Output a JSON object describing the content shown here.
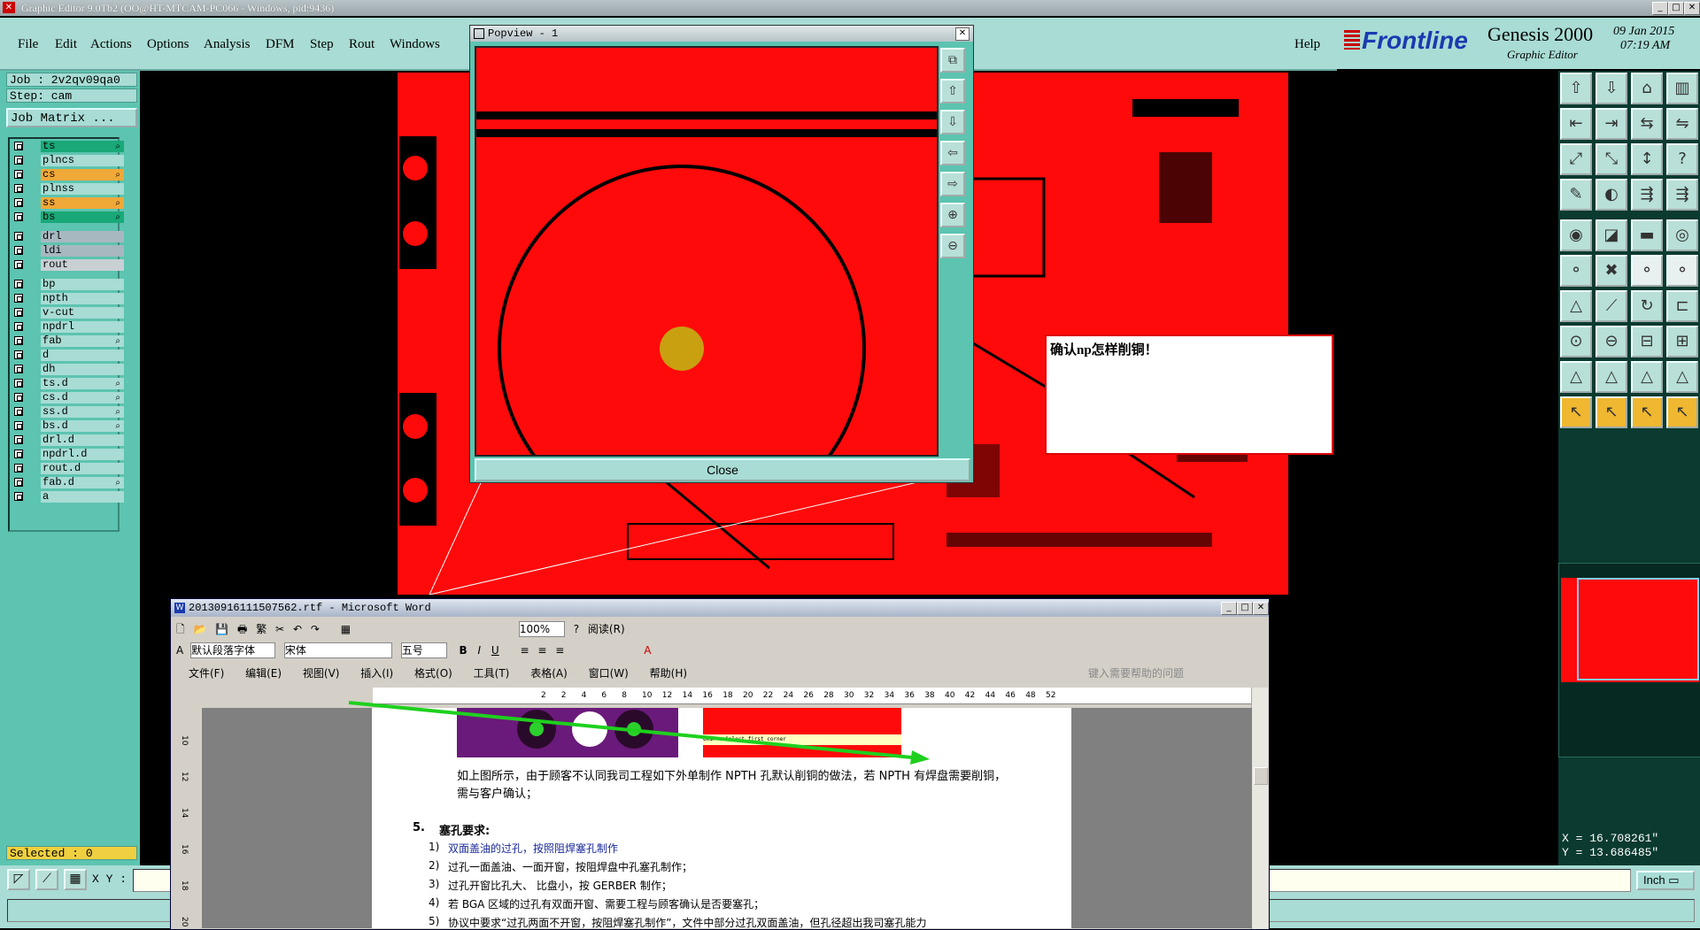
{
  "window": {
    "title": "Graphic Editor 9.0Tb2 (OO@HT-MTCAM-PC066 - Windows, pid:9436)"
  },
  "menubar": {
    "items": [
      "File",
      "Edit",
      "Actions",
      "Options",
      "Analysis",
      "DFM",
      "Step",
      "Rout",
      "Windows"
    ],
    "help": "Help"
  },
  "brand": {
    "logo": "Frontline",
    "product": "Genesis 2000",
    "subtitle": "Graphic Editor",
    "date": "09 Jan 2015",
    "time": "07:19 AM"
  },
  "left_panel": {
    "job": "Job : 2v2qv09qa0",
    "step": "Step: cam",
    "job_matrix_button": "Job Matrix ...",
    "layers": [
      {
        "name": "ts",
        "color": "#1aa878",
        "icon": true
      },
      {
        "name": "plncs",
        "color": "#a8dcd4",
        "icon": false
      },
      {
        "name": "cs",
        "color": "#f0a838",
        "icon": true
      },
      {
        "name": "plnss",
        "color": "#a8dcd4",
        "icon": false
      },
      {
        "name": "ss",
        "color": "#f0a838",
        "icon": true
      },
      {
        "name": "bs",
        "color": "#1aa878",
        "icon": true
      },
      {
        "name": "drl",
        "color": "#a8b8c0",
        "icon": false
      },
      {
        "name": "ldi",
        "color": "#a8b8c0",
        "icon": false
      },
      {
        "name": "rout",
        "color": "#c8d0d4",
        "icon": false
      },
      {
        "name": "bp",
        "color": "#a8dcd4",
        "icon": false
      },
      {
        "name": "npth",
        "color": "#a8dcd4",
        "icon": false
      },
      {
        "name": "v-cut",
        "color": "#a8dcd4",
        "icon": false
      },
      {
        "name": "npdrl",
        "color": "#a8dcd4",
        "icon": false
      },
      {
        "name": "fab",
        "color": "#a8dcd4",
        "icon": true
      },
      {
        "name": "d",
        "color": "#a8dcd4",
        "icon": false
      },
      {
        "name": "dh",
        "color": "#a8dcd4",
        "icon": false
      },
      {
        "name": "ts.d",
        "color": "#a8dcd4",
        "icon": true
      },
      {
        "name": "cs.d",
        "color": "#a8dcd4",
        "icon": true
      },
      {
        "name": "ss.d",
        "color": "#a8dcd4",
        "icon": true
      },
      {
        "name": "bs.d",
        "color": "#a8dcd4",
        "icon": true
      },
      {
        "name": "drl.d",
        "color": "#a8dcd4",
        "icon": false
      },
      {
        "name": "npdrl.d",
        "color": "#a8dcd4",
        "icon": false
      },
      {
        "name": "rout.d",
        "color": "#a8dcd4",
        "icon": false
      },
      {
        "name": "fab.d",
        "color": "#a8dcd4",
        "icon": true
      },
      {
        "name": "a",
        "color": "#a8dcd4",
        "icon": false
      }
    ],
    "selected": "Selected : 0"
  },
  "popview": {
    "title": "Popview - 1",
    "close_label": "Close"
  },
  "message": {
    "text": "确认np怎样削铜！"
  },
  "coords": {
    "x": "X = 16.708261\"",
    "y": "Y = 13.686485\""
  },
  "status": {
    "xy_label": "X Y :",
    "xy_value": "",
    "unit": "Inch"
  },
  "word": {
    "title": "20130916111507562.rtf - Microsoft Word",
    "style": "默认段落字体",
    "font": "宋体",
    "size": "五号",
    "zoom": "100%",
    "read": "阅读(R)",
    "menu": [
      "文件(F)",
      "编辑(E)",
      "视图(V)",
      "插入(I)",
      "格式(O)",
      "工具(T)",
      "表格(A)",
      "窗口(W)",
      "帮助(H)"
    ],
    "help_placeholder": "键入需要帮助的问题",
    "ruler": [
      "2",
      "2",
      "4",
      "6",
      "8",
      "10",
      "12",
      "14",
      "16",
      "18",
      "20",
      "22",
      "24",
      "26",
      "28",
      "30",
      "32",
      "34",
      "36",
      "38",
      "40",
      "42",
      "44",
      "46",
      "48",
      "52"
    ],
    "vruler": [
      "10",
      "12",
      "14",
      "16",
      "18",
      "20"
    ],
    "para1_line1": "如上图所示，由于顾客不认同我司工程如下外单制作 NPTH 孔默认削铜的做法，若 NPTH 有焊盘需要削铜，",
    "para1_line2": "需与客户确认；",
    "section_num": "5.",
    "section_title": "塞孔要求:",
    "items": [
      {
        "n": "1)",
        "t": "双面盖油的过孔，按照阻焊塞孔制作"
      },
      {
        "n": "2)",
        "t": "过孔一面盖油、一面开窗，按阻焊盘中孔塞孔制作；"
      },
      {
        "n": "3)",
        "t": "过孔开窗比孔大、 比盘小，按 GERBER 制作；"
      },
      {
        "n": "4)",
        "t": "若 BGA 区域的过孔有双面开窗、需要工程与顾客确认是否要塞孔；"
      },
      {
        "n": "5)",
        "t": "协议中要求“过孔两面不开窗，按阻焊塞孔制作”，文件中部分过孔双面盖油，但孔径超出我司塞孔能力"
      }
    ],
    "screenshot_label": "OK1> - Select first corner"
  },
  "colors": {
    "teal": "#5cc4b0",
    "light_teal": "#a8dcd4",
    "pcb_red": "#ff0a0a",
    "copper_gold": "#c8a010"
  }
}
